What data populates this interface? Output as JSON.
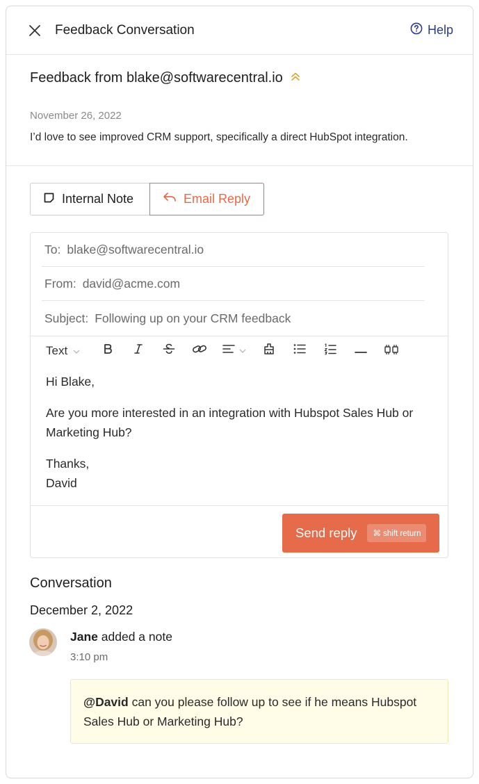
{
  "header": {
    "title": "Feedback Conversation",
    "help_label": "Help",
    "close_icon": "close-icon",
    "help_icon": "question-circle-icon"
  },
  "feedback": {
    "title": "Feedback from blake@softwarecentral.io",
    "priority_icon": "double-chevron-up-icon",
    "date": "November 26, 2022",
    "body": "I’d love to see improved CRM support, specifically a direct HubSpot integration."
  },
  "tabs": [
    {
      "label": "Internal Note",
      "icon": "note-icon",
      "active": false
    },
    {
      "label": "Email Reply",
      "icon": "reply-arrow-icon",
      "active": true
    }
  ],
  "composer": {
    "to_label": "To:",
    "to_value": "blake@softwarecentral.io",
    "from_label": "From:",
    "from_value": "david@acme.com",
    "subject_label": "Subject:",
    "subject_value": "Following up on your CRM feedback",
    "toolbar": {
      "text_style": "Text",
      "buttons": [
        "bold",
        "italic",
        "strikethrough",
        "link",
        "align",
        "clear-format",
        "bullet-list",
        "numbered-list",
        "horizontal-rule",
        "quote"
      ]
    },
    "body": {
      "greeting": "Hi Blake,",
      "message": "Are you more interested in an integration with Hubspot Sales Hub or Marketing Hub?",
      "signoff": "Thanks,",
      "signature": "David"
    },
    "send_label": "Send reply",
    "send_shortcut": "⌘ shift return"
  },
  "conversation": {
    "title": "Conversation",
    "date": "December 2, 2022",
    "entries": [
      {
        "author": "Jane",
        "action": "added a note",
        "time": "3:10 pm",
        "mention": "@David",
        "note": "can you please follow up to see if he means Hubspot Sales Hub or Marketing Hub?"
      }
    ]
  },
  "colors": {
    "accent": "#e66b4b",
    "help_link": "#2b3a8c",
    "priority": "#d9a82e",
    "note_bg": "#fffde7"
  }
}
